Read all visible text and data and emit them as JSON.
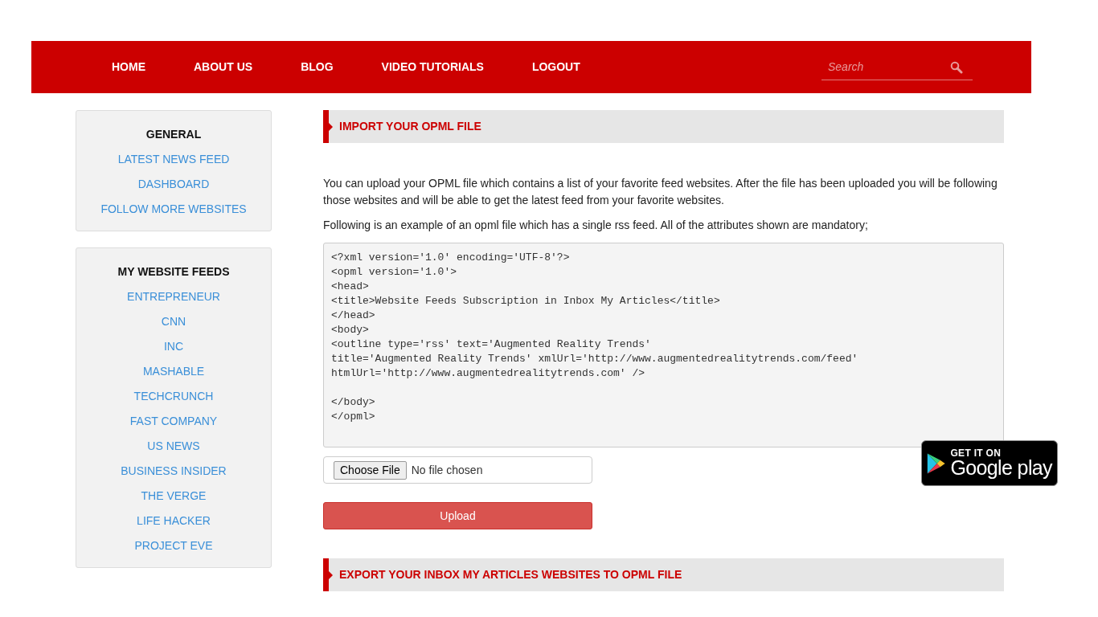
{
  "nav": {
    "items": [
      {
        "label": "HOME"
      },
      {
        "label": "ABOUT US"
      },
      {
        "label": "BLOG"
      },
      {
        "label": "VIDEO TUTORIALS"
      },
      {
        "label": "LOGOUT"
      }
    ],
    "search": {
      "placeholder": "Search"
    }
  },
  "sidebar": [
    {
      "title": "GENERAL",
      "links": [
        "LATEST NEWS FEED",
        "DASHBOARD",
        "FOLLOW MORE WEBSITES"
      ]
    },
    {
      "title": "MY WEBSITE FEEDS",
      "links": [
        "ENTREPRENEUR",
        "CNN",
        "INC",
        "MASHABLE",
        "TECHCRUNCH",
        "FAST COMPANY",
        "US NEWS",
        "BUSINESS INSIDER",
        "THE VERGE",
        "LIFE HACKER",
        "PROJECT EVE"
      ]
    }
  ],
  "import_section": {
    "heading": "IMPORT YOUR OPML FILE",
    "paragraphs": [
      "You can upload your OPML file which contains a list of your favorite feed websites. After the file has been uploaded you will be following those websites and will be able to get the latest feed from your favorite websites.",
      "Following is an example of an opml file which has a single rss feed. All of the attributes shown are mandatory;"
    ],
    "code": "<?xml version='1.0' encoding='UTF-8'?>\n<opml version='1.0'>\n<head>\n<title>Website Feeds Subscription in Inbox My Articles</title>\n</head>\n<body>\n<outline type='rss' text='Augmented Reality Trends'\ntitle='Augmented Reality Trends' xmlUrl='http://www.augmentedrealitytrends.com/feed'\nhtmlUrl='http://www.augmentedrealitytrends.com' />\n\n</body>\n</opml>",
    "file_input": {
      "button": "Choose File",
      "status": "No file chosen"
    },
    "upload_button": "Upload"
  },
  "export_section": {
    "heading": "EXPORT YOUR INBOX MY ARTICLES WEBSITES TO OPML FILE"
  },
  "store_badge": {
    "top_text": "GET IT ON",
    "main_text": "Google play"
  }
}
